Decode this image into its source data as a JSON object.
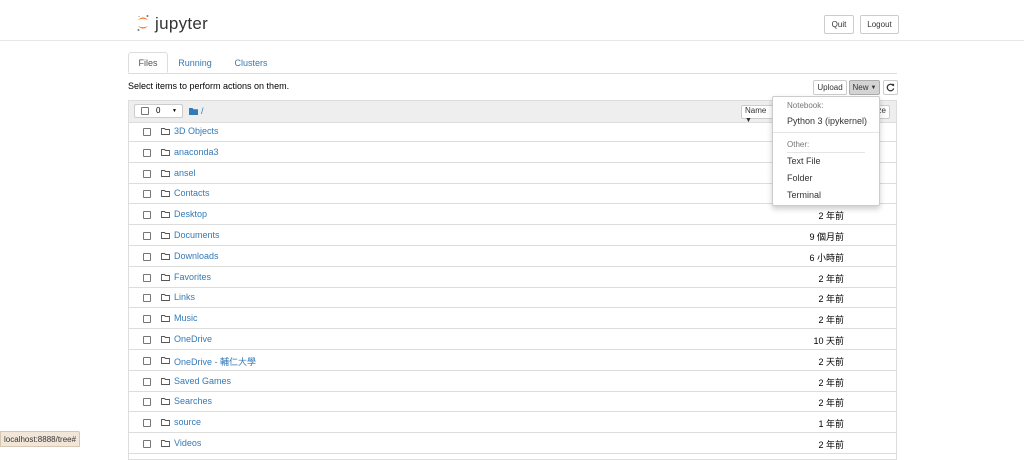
{
  "header": {
    "logo_text": "jupyter",
    "quit_label": "Quit",
    "logout_label": "Logout"
  },
  "tabs": [
    {
      "label": "Files",
      "active": true
    },
    {
      "label": "Running",
      "active": false
    },
    {
      "label": "Clusters",
      "active": false
    }
  ],
  "toolbar": {
    "instructions": "Select items to perform actions on them.",
    "upload_label": "Upload",
    "new_label": "New"
  },
  "list_header": {
    "selected_count": "0",
    "path": "/",
    "name_col": "Name",
    "size_col_fragment": "ze"
  },
  "rows": [
    {
      "name": "3D Objects",
      "time": ""
    },
    {
      "name": "anaconda3",
      "time": ""
    },
    {
      "name": "ansel",
      "time": ""
    },
    {
      "name": "Contacts",
      "time": ""
    },
    {
      "name": "Desktop",
      "time": "2 年前"
    },
    {
      "name": "Documents",
      "time": "9 個月前"
    },
    {
      "name": "Downloads",
      "time": "6 小時前"
    },
    {
      "name": "Favorites",
      "time": "2 年前"
    },
    {
      "name": "Links",
      "time": "2 年前"
    },
    {
      "name": "Music",
      "time": "2 年前"
    },
    {
      "name": "OneDrive",
      "time": "10 天前"
    },
    {
      "name": "OneDrive - 輔仁大學",
      "time": "2 天前"
    },
    {
      "name": "Saved Games",
      "time": "2 年前"
    },
    {
      "name": "Searches",
      "time": "2 年前"
    },
    {
      "name": "source",
      "time": "1 年前"
    },
    {
      "name": "Videos",
      "time": "2 年前"
    }
  ],
  "new_menu": {
    "notebook_header": "Notebook:",
    "python_kernel": "Python 3 (ipykernel)",
    "other_header": "Other:",
    "text_file": "Text File",
    "folder": "Folder",
    "terminal": "Terminal"
  },
  "status_url": "localhost:8888/tree#",
  "colors": {
    "link": "#337ab7",
    "logo_orange": "#f37726",
    "folder_icon": "#337ab7"
  }
}
